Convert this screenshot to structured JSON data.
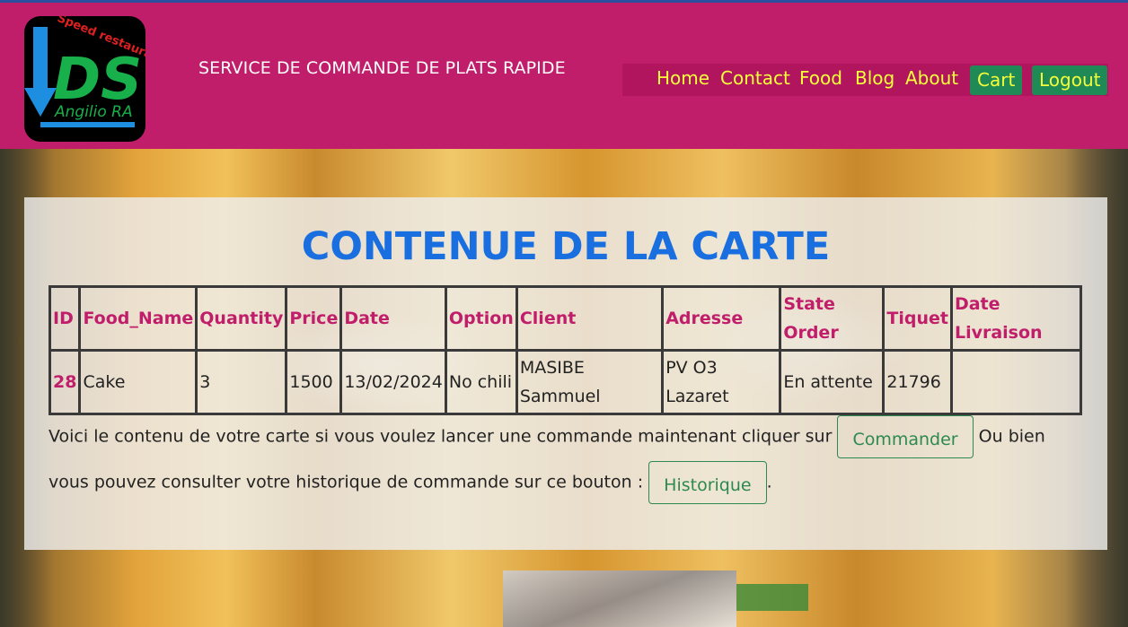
{
  "header": {
    "logo_text_main": "DS",
    "logo_text_arc": "Speed restauration",
    "logo_text_author": "Angilio RA",
    "service_title": "SERVICE DE COMMANDE DE PLATS RAPIDE",
    "nav": [
      {
        "label": "Home"
      },
      {
        "label": "Contact"
      },
      {
        "label": "Food"
      },
      {
        "label": "Blog"
      },
      {
        "label": "About"
      },
      {
        "label": "Cart"
      },
      {
        "label": "Logout"
      }
    ]
  },
  "main": {
    "heading": "CONTENUE DE LA CARTE",
    "table": {
      "columns": [
        "ID",
        "Food_Name",
        "Quantity",
        "Price",
        "Date",
        "Option",
        "Client",
        "Adresse",
        "State Order",
        "Tiquet",
        "Date Livraison"
      ],
      "rows": [
        {
          "id": "28",
          "food_name": "Cake",
          "quantity": "3",
          "price": "1500",
          "date": "13/02/2024",
          "option": "No chili",
          "client": "MASIBE Sammuel",
          "adresse": "PV O3 Lazaret",
          "state_order": "En attente",
          "tiquet": "21796",
          "date_livraison": ""
        }
      ]
    },
    "text_part1": "Voici le contenu de votre carte si vous voulez lancer une commande maintenant cliquer sur",
    "commander_label": "Commander",
    "text_part2": "Ou bien",
    "text_part3": "vous pouvez consulter votre historique de commande sur ce bouton :",
    "historique_label": "Historique",
    "text_part4": "."
  },
  "colors": {
    "header_bg": "#c01e6a",
    "nav_text": "#f6ff3a",
    "nav_button_bg": "#1f8a55",
    "heading": "#1a6fe0",
    "table_header_text": "#c01e6a",
    "outline_button": "#2c8a4e"
  }
}
